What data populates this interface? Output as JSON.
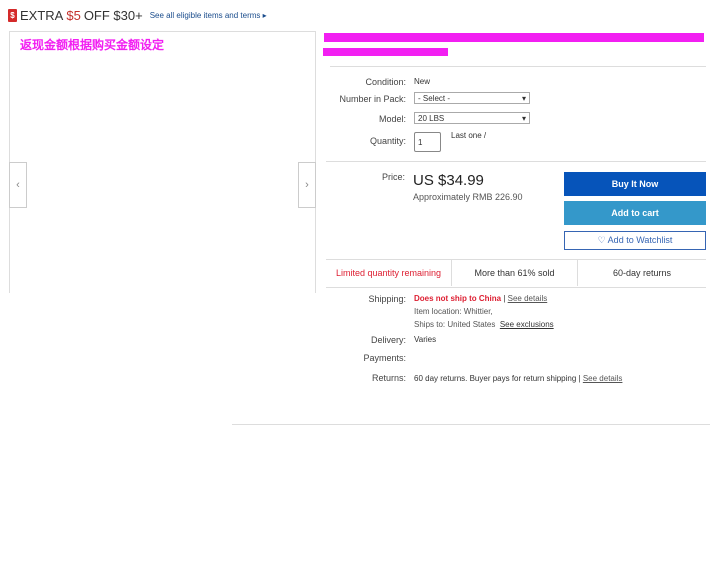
{
  "promo": {
    "extra": "EXTRA",
    "amount": "$5",
    "off": "OFF $30+",
    "terms": "See all eligible items and terms ▸",
    "tag_icon": "$"
  },
  "image": {
    "overlay_text": "返现金额根据购买金额设定",
    "prev": "‹",
    "next": "›"
  },
  "details": {
    "condition_label": "Condition:",
    "condition": "New",
    "pack_label": "Number in Pack:",
    "pack_value": "- Select -",
    "model_label": "Model:",
    "model_value": "20 LBS",
    "quantity_label": "Quantity:",
    "quantity": "1",
    "stock": "Last one /"
  },
  "price": {
    "label": "Price:",
    "value": "US $34.99",
    "approx": "Approximately RMB 226.90"
  },
  "buttons": {
    "buy": "Buy It Now",
    "cart": "Add to cart",
    "watch": "♡ Add to Watchlist"
  },
  "highlights": [
    "Limited quantity remaining",
    "More than 61% sold",
    "60-day returns"
  ],
  "shipping": {
    "label": "Shipping:",
    "status": "Does not ship to China",
    "sep": " | ",
    "details": "See details",
    "location": "Item location: Whittier,",
    "ships_to": "Ships to: United States",
    "exclusions": "See exclusions",
    "delivery_label": "Delivery:",
    "delivery": "Varies",
    "payments_label": "Payments:",
    "returns_label": "Returns:",
    "returns": "60 day returns. Buyer pays for return shipping | ",
    "returns_link": "See details"
  },
  "colors": {
    "buy": "#0654ba",
    "cart": "#3498ca",
    "alert": "#dd1e31",
    "redact": "#f21ff2"
  }
}
